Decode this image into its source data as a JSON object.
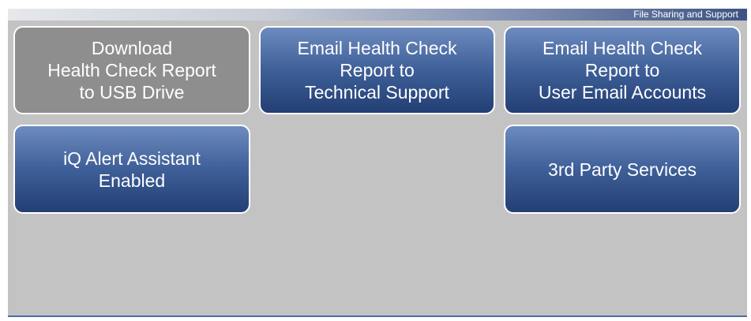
{
  "header": {
    "title": "File Sharing and Support"
  },
  "buttons": {
    "download_report": {
      "lines": [
        "Download",
        "Health Check Report",
        "to USB Drive"
      ],
      "state": "disabled"
    },
    "email_support": {
      "lines": [
        "Email Health Check",
        "Report to",
        "Technical Support"
      ]
    },
    "email_users": {
      "lines": [
        "Email Health Check",
        "Report to",
        "User Email Accounts"
      ]
    },
    "iq_alert": {
      "lines": [
        "iQ Alert Assistant",
        "Enabled"
      ]
    },
    "third_party": {
      "lines": [
        "3rd Party Services"
      ]
    }
  },
  "colors": {
    "screen_background": "#c3c3c3",
    "button_blue_top": "#6d8bbf",
    "button_blue_bottom": "#233f74",
    "button_disabled": "#8e8e8e",
    "button_border": "#ffffff"
  }
}
